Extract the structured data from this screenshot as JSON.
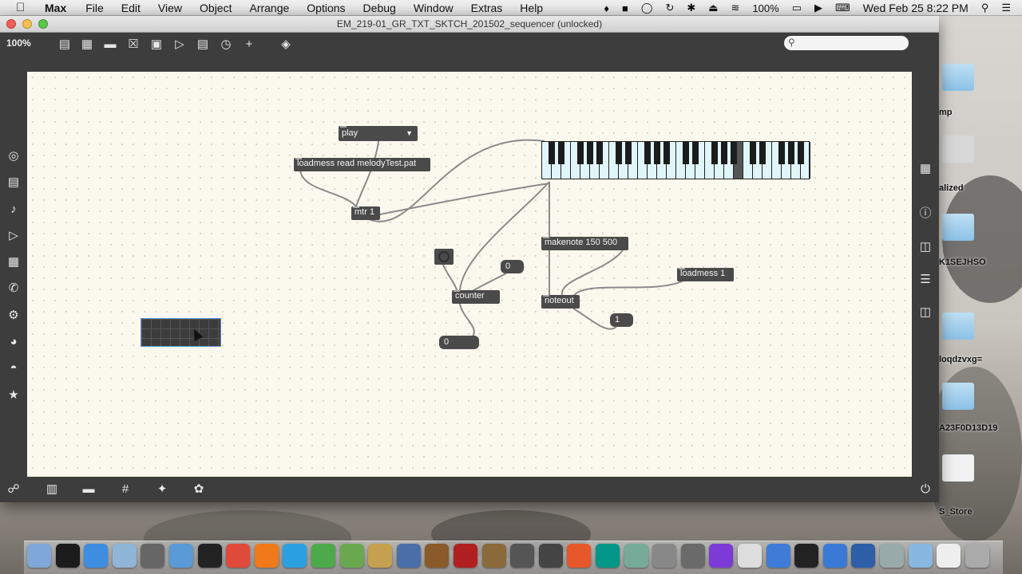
{
  "menubar": {
    "app": "Max",
    "items": [
      "File",
      "Edit",
      "View",
      "Object",
      "Arrange",
      "Options",
      "Debug",
      "Window",
      "Extras",
      "Help"
    ],
    "battery": "100%",
    "datetime": "Wed Feb 25  8:22 PM"
  },
  "window": {
    "title": "EM_219-01_GR_TXT_SKTCH_201502_sequencer (unlocked)",
    "zoom": "100%"
  },
  "patch": {
    "umenu": "play",
    "loadmess_read": "loadmess read melodyTest.pat",
    "metro": "mtr 1",
    "makenote": "makenote 150 500",
    "loadmess_1": "loadmess 1",
    "counter": "counter",
    "noteout": "noteout",
    "num_counter_max": "0",
    "num_counter_out": "0",
    "num_channel": "1"
  },
  "desktop_labels": [
    "mp",
    "alized",
    "K1SEJHSO",
    "loqdzvxg=",
    "A23F0D13D19",
    "S_Store"
  ]
}
